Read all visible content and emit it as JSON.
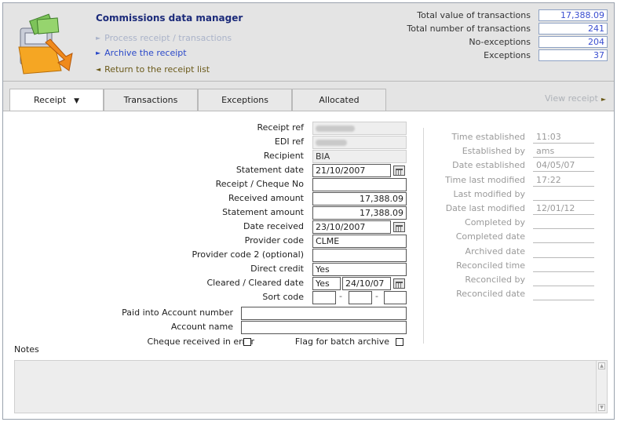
{
  "header": {
    "title": "Commissions data manager",
    "actions": [
      {
        "label": "Process receipt / transactions",
        "state": "disabled"
      },
      {
        "label": "Archive the receipt",
        "state": "active"
      },
      {
        "label": "Return to the receipt list",
        "state": "back"
      }
    ],
    "stats": [
      {
        "label": "Total value of transactions",
        "value": "17,388.09"
      },
      {
        "label": "Total number of transactions",
        "value": "241"
      },
      {
        "label": "No-exceptions",
        "value": "204"
      },
      {
        "label": "Exceptions",
        "value": "37"
      }
    ]
  },
  "tabs": [
    {
      "label": "Receipt",
      "active": true
    },
    {
      "label": "Transactions"
    },
    {
      "label": "Exceptions"
    },
    {
      "label": "Allocated"
    }
  ],
  "view_receipt": "View receipt",
  "form": {
    "receipt_ref_label": "Receipt ref",
    "edi_ref_label": "EDI ref",
    "recipient_label": "Recipient",
    "recipient_value": "BIA",
    "statement_date_label": "Statement date",
    "statement_date_value": "21/10/2007",
    "cheque_no_label": "Receipt / Cheque No",
    "cheque_no_value": "",
    "received_amount_label": "Received amount",
    "received_amount_value": "17,388.09",
    "statement_amount_label": "Statement amount",
    "statement_amount_value": "17,388.09",
    "date_received_label": "Date received",
    "date_received_value": "23/10/2007",
    "provider_code_label": "Provider code",
    "provider_code_value": "CLME",
    "provider_code2_label": "Provider code 2 (optional)",
    "provider_code2_value": "",
    "direct_credit_label": "Direct credit",
    "direct_credit_value": "Yes",
    "cleared_label": "Cleared / Cleared date",
    "cleared_value": "Yes",
    "cleared_date_value": "24/10/07",
    "sort_code_label": "Sort code",
    "sort_code_sep": "-",
    "paid_into_label": "Paid into Account number",
    "account_name_label": "Account name",
    "cheque_error_label": "Cheque received in error",
    "flag_batch_label": "Flag for batch archive"
  },
  "audit": [
    {
      "label": "Time established",
      "value": "11:03"
    },
    {
      "label": "Established by",
      "value": "ams"
    },
    {
      "label": "Date established",
      "value": "04/05/07"
    },
    {
      "label": "Time last modified",
      "value": "17:22"
    },
    {
      "label": "Last modified by",
      "value": ""
    },
    {
      "label": "Date last modified",
      "value": "12/01/12"
    },
    {
      "label": "Completed by",
      "value": ""
    },
    {
      "label": "Completed date",
      "value": ""
    },
    {
      "label": "Archived date",
      "value": ""
    },
    {
      "label": "Reconciled time",
      "value": ""
    },
    {
      "label": "Reconciled by",
      "value": ""
    },
    {
      "label": "Reconciled date",
      "value": ""
    }
  ],
  "notes_label": "Notes",
  "colors": {
    "accent": "#2b49c8",
    "title": "#1c2b7a",
    "stat_value": "#3a4ed0"
  }
}
